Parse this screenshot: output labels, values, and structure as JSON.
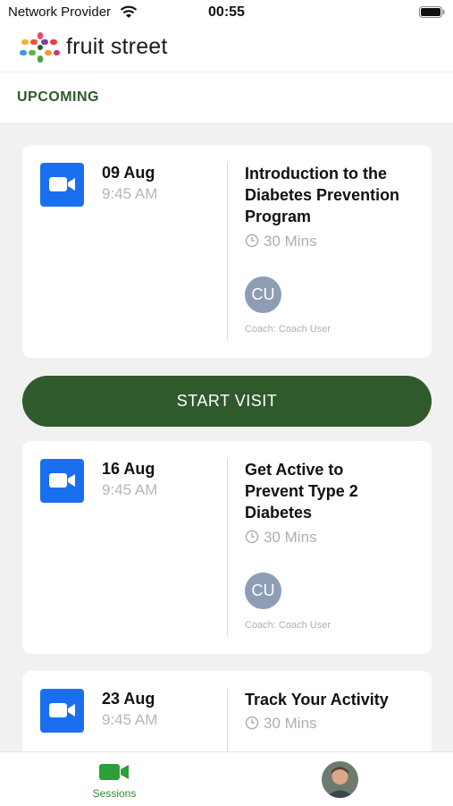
{
  "status": {
    "carrier": "Network Provider",
    "time": "00:55"
  },
  "header": {
    "brand": "fruit street"
  },
  "section": {
    "title": "UPCOMING"
  },
  "sessions": [
    {
      "date": "09 Aug",
      "time": "9:45 AM",
      "title": "Introduction to the Diabetes Prevention Program",
      "duration": "30 Mins",
      "coach_initials": "CU",
      "coach": "Coach: Coach User"
    },
    {
      "date": "16 Aug",
      "time": "9:45 AM",
      "title": "Get Active to Prevent Type 2 Diabetes",
      "duration": "30 Mins",
      "coach_initials": "CU",
      "coach": "Coach: Coach User"
    },
    {
      "date": "23 Aug",
      "time": "9:45 AM",
      "title": "Track Your Activity",
      "duration": "30 Mins"
    }
  ],
  "actions": {
    "start_visit": "START VISIT"
  },
  "tabbar": {
    "sessions_label": "Sessions"
  },
  "colors": {
    "accent_green": "#2f5a2c",
    "video_blue": "#1a6ff0",
    "avatar_gray": "#8f9cb6"
  }
}
